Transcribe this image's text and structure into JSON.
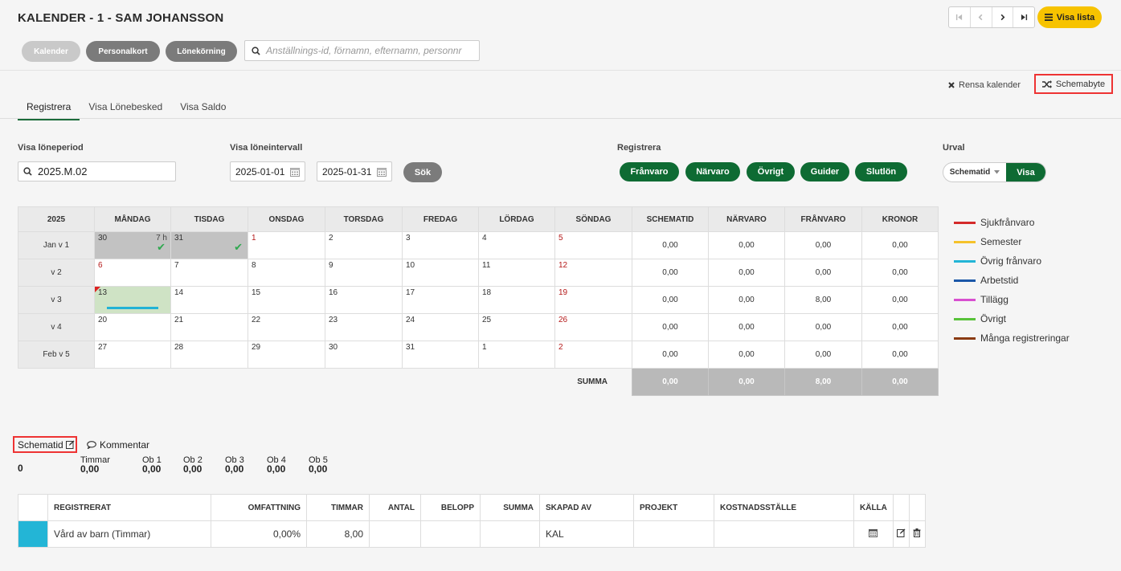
{
  "header": {
    "title": "KALENDER - 1 - SAM JOHANSSON",
    "buttons": {
      "kalender": "Kalender",
      "personalkort": "Personalkort",
      "lonekorning": "Lönekörning"
    },
    "search_placeholder": "Anställnings-id, förnamn, efternamn, personnr",
    "visa_lista": "Visa lista"
  },
  "actions": {
    "rensa": "Rensa kalender",
    "schemabyte": "Schemabyte"
  },
  "tabs": [
    "Registrera",
    "Visa Lönebesked",
    "Visa Saldo"
  ],
  "filters": {
    "loneperiod_label": "Visa löneperiod",
    "loneperiod_value": "2025.M.02",
    "intervall_label": "Visa löneintervall",
    "from": "2025-01-01",
    "to": "2025-01-31",
    "sok": "Sök",
    "registrera_label": "Registrera",
    "registrera_buttons": [
      "Frånvaro",
      "Närvaro",
      "Övrigt",
      "Guider",
      "Slutlön"
    ],
    "urval_label": "Urval",
    "urval_value": "Schematid",
    "urval_visa": "Visa"
  },
  "calendar": {
    "year": "2025",
    "days": [
      "MÅNDAG",
      "TISDAG",
      "ONSDAG",
      "TORSDAG",
      "FREDAG",
      "LÖRDAG",
      "SÖNDAG"
    ],
    "sum_headers": [
      "SCHEMATID",
      "NÄRVARO",
      "FRÅNVARO",
      "KRONOR"
    ],
    "weeks": [
      {
        "label": "Jan v 1",
        "days": [
          "30",
          "31",
          "1",
          "2",
          "3",
          "4",
          "5"
        ],
        "sums": [
          "0,00",
          "0,00",
          "0,00",
          "0,00"
        ]
      },
      {
        "label": "v 2",
        "days": [
          "6",
          "7",
          "8",
          "9",
          "10",
          "11",
          "12"
        ],
        "sums": [
          "0,00",
          "0,00",
          "0,00",
          "0,00"
        ]
      },
      {
        "label": "v 3",
        "days": [
          "13",
          "14",
          "15",
          "16",
          "17",
          "18",
          "19"
        ],
        "sums": [
          "0,00",
          "0,00",
          "8,00",
          "0,00"
        ]
      },
      {
        "label": "v 4",
        "days": [
          "20",
          "21",
          "22",
          "23",
          "24",
          "25",
          "26"
        ],
        "sums": [
          "0,00",
          "0,00",
          "0,00",
          "0,00"
        ]
      },
      {
        "label": "Feb v 5",
        "days": [
          "27",
          "28",
          "29",
          "30",
          "31",
          "1",
          "2"
        ],
        "sums": [
          "0,00",
          "0,00",
          "0,00",
          "0,00"
        ]
      }
    ],
    "hours_label": "7 h",
    "summa_label": "SUMMA",
    "summa": [
      "0,00",
      "0,00",
      "8,00",
      "0,00"
    ]
  },
  "legend": [
    {
      "label": "Sjukfrånvaro",
      "color": "#d42a2a"
    },
    {
      "label": "Semester",
      "color": "#f5c22b"
    },
    {
      "label": "Övrig frånvaro",
      "color": "#23b5d6"
    },
    {
      "label": "Arbetstid",
      "color": "#1b57a8"
    },
    {
      "label": "Tillägg",
      "color": "#d84fd0"
    },
    {
      "label": "Övrigt",
      "color": "#58c23a"
    },
    {
      "label": "Många registreringar",
      "color": "#8a3a12"
    }
  ],
  "schematid_section": {
    "schematid": "Schematid",
    "kommentar": "Kommentar",
    "total": "0",
    "stats": [
      {
        "label": "Timmar",
        "value": "0,00"
      },
      {
        "label": "Ob 1",
        "value": "0,00"
      },
      {
        "label": "Ob 2",
        "value": "0,00"
      },
      {
        "label": "Ob 3",
        "value": "0,00"
      },
      {
        "label": "Ob 4",
        "value": "0,00"
      },
      {
        "label": "Ob 5",
        "value": "0,00"
      }
    ]
  },
  "registrations": {
    "headers": [
      "REGISTRERAT",
      "OMFATTNING",
      "TIMMAR",
      "ANTAL",
      "BELOPP",
      "SUMMA",
      "SKAPAD AV",
      "PROJEKT",
      "KOSTNADSSTÄLLE",
      "KÄLLA"
    ],
    "rows": [
      {
        "color": "#23b5d6",
        "registrerat": "Vård av barn (Timmar)",
        "omfattning": "0,00%",
        "timmar": "8,00",
        "antal": "",
        "belopp": "",
        "summa": "",
        "skapad_av": "KAL",
        "projekt": "",
        "kostnadsstalle": ""
      }
    ]
  }
}
